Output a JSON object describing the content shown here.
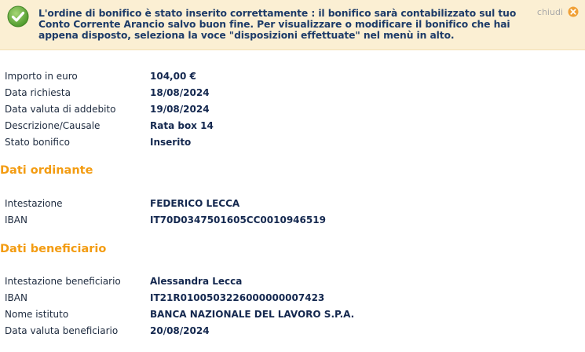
{
  "banner": {
    "message": "L'ordine di bonifico è stato inserito correttamente : il bonifico sarà contabilizzato sul tuo Conto Corrente Arancio salvo buon fine. Per visualizzare o modificare il bonifico che hai appena disposto, seleziona la voce \"disposizioni effettuate\" nel menù in alto.",
    "close_label": "chiudi",
    "icon": "check-circle-icon",
    "close_icon": "close-circle-icon",
    "colors": {
      "background": "#fbefd3",
      "icon_green": "#5fa73a",
      "close_orange": "#f0a035"
    }
  },
  "summary": [
    {
      "label": "Importo in euro",
      "value": "104,00 €"
    },
    {
      "label": "Data richiesta",
      "value": "18/08/2024"
    },
    {
      "label": "Data valuta di addebito",
      "value": "19/08/2024"
    },
    {
      "label": "Descrizione/Causale",
      "value": "Rata box 14"
    },
    {
      "label": "Stato bonifico",
      "value": "Inserito"
    }
  ],
  "ordinante": {
    "title": "Dati ordinante",
    "rows": [
      {
        "label": "Intestazione",
        "value": "FEDERICO LECCA"
      },
      {
        "label": "IBAN",
        "value": "IT70D0347501605CC0010946519"
      }
    ]
  },
  "beneficiario": {
    "title": "Dati beneficiario",
    "rows": [
      {
        "label": "Intestazione beneficiario",
        "value": "Alessandra Lecca"
      },
      {
        "label": "IBAN",
        "value": "IT21R0100503226000000007423"
      },
      {
        "label": "Nome istituto",
        "value": "BANCA NAZIONALE DEL LAVORO S.P.A."
      },
      {
        "label": "Data valuta beneficiario",
        "value": "20/08/2024"
      }
    ]
  },
  "accent_color": "#f39c12"
}
